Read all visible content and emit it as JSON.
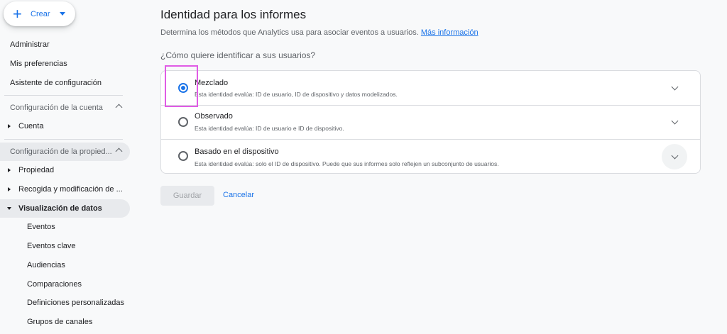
{
  "sidebar": {
    "create_label": "Crear",
    "top_items": [
      "Administrar",
      "Mis preferencias",
      "Asistente de configuración"
    ],
    "account_section": "Configuración de la cuenta",
    "account_items": [
      "Cuenta"
    ],
    "property_section": "Configuración de la propied...",
    "property_items": [
      "Propiedad",
      "Recogida y modificación de ...",
      "Visualización de datos"
    ],
    "sub_items": [
      "Eventos",
      "Eventos clave",
      "Audiencias",
      "Comparaciones",
      "Definiciones personalizadas",
      "Grupos de canales"
    ]
  },
  "main": {
    "title": "Identidad para los informes",
    "description": "Determina los métodos que Analytics usa para asociar eventos a usuarios.",
    "more_info_link": "Más información",
    "question": "¿Cómo quiere identificar a sus usuarios?",
    "options": [
      {
        "title": "Mezclado",
        "desc": "Esta identidad evalúa: ID de usuario, ID de dispositivo y datos modelizados.",
        "selected": true
      },
      {
        "title": "Observado",
        "desc": "Esta identidad evalúa: ID de usuario e ID de dispositivo.",
        "selected": false
      },
      {
        "title": "Basado en el dispositivo",
        "desc": "Esta identidad evalúa: solo el ID de dispositivo. Puede que sus informes solo reflejen un subconjunto de usuarios.",
        "selected": false
      }
    ],
    "save_label": "Guardar",
    "cancel_label": "Cancelar"
  },
  "colors": {
    "accent": "#1a73e8",
    "highlight": "#e05ce5"
  }
}
